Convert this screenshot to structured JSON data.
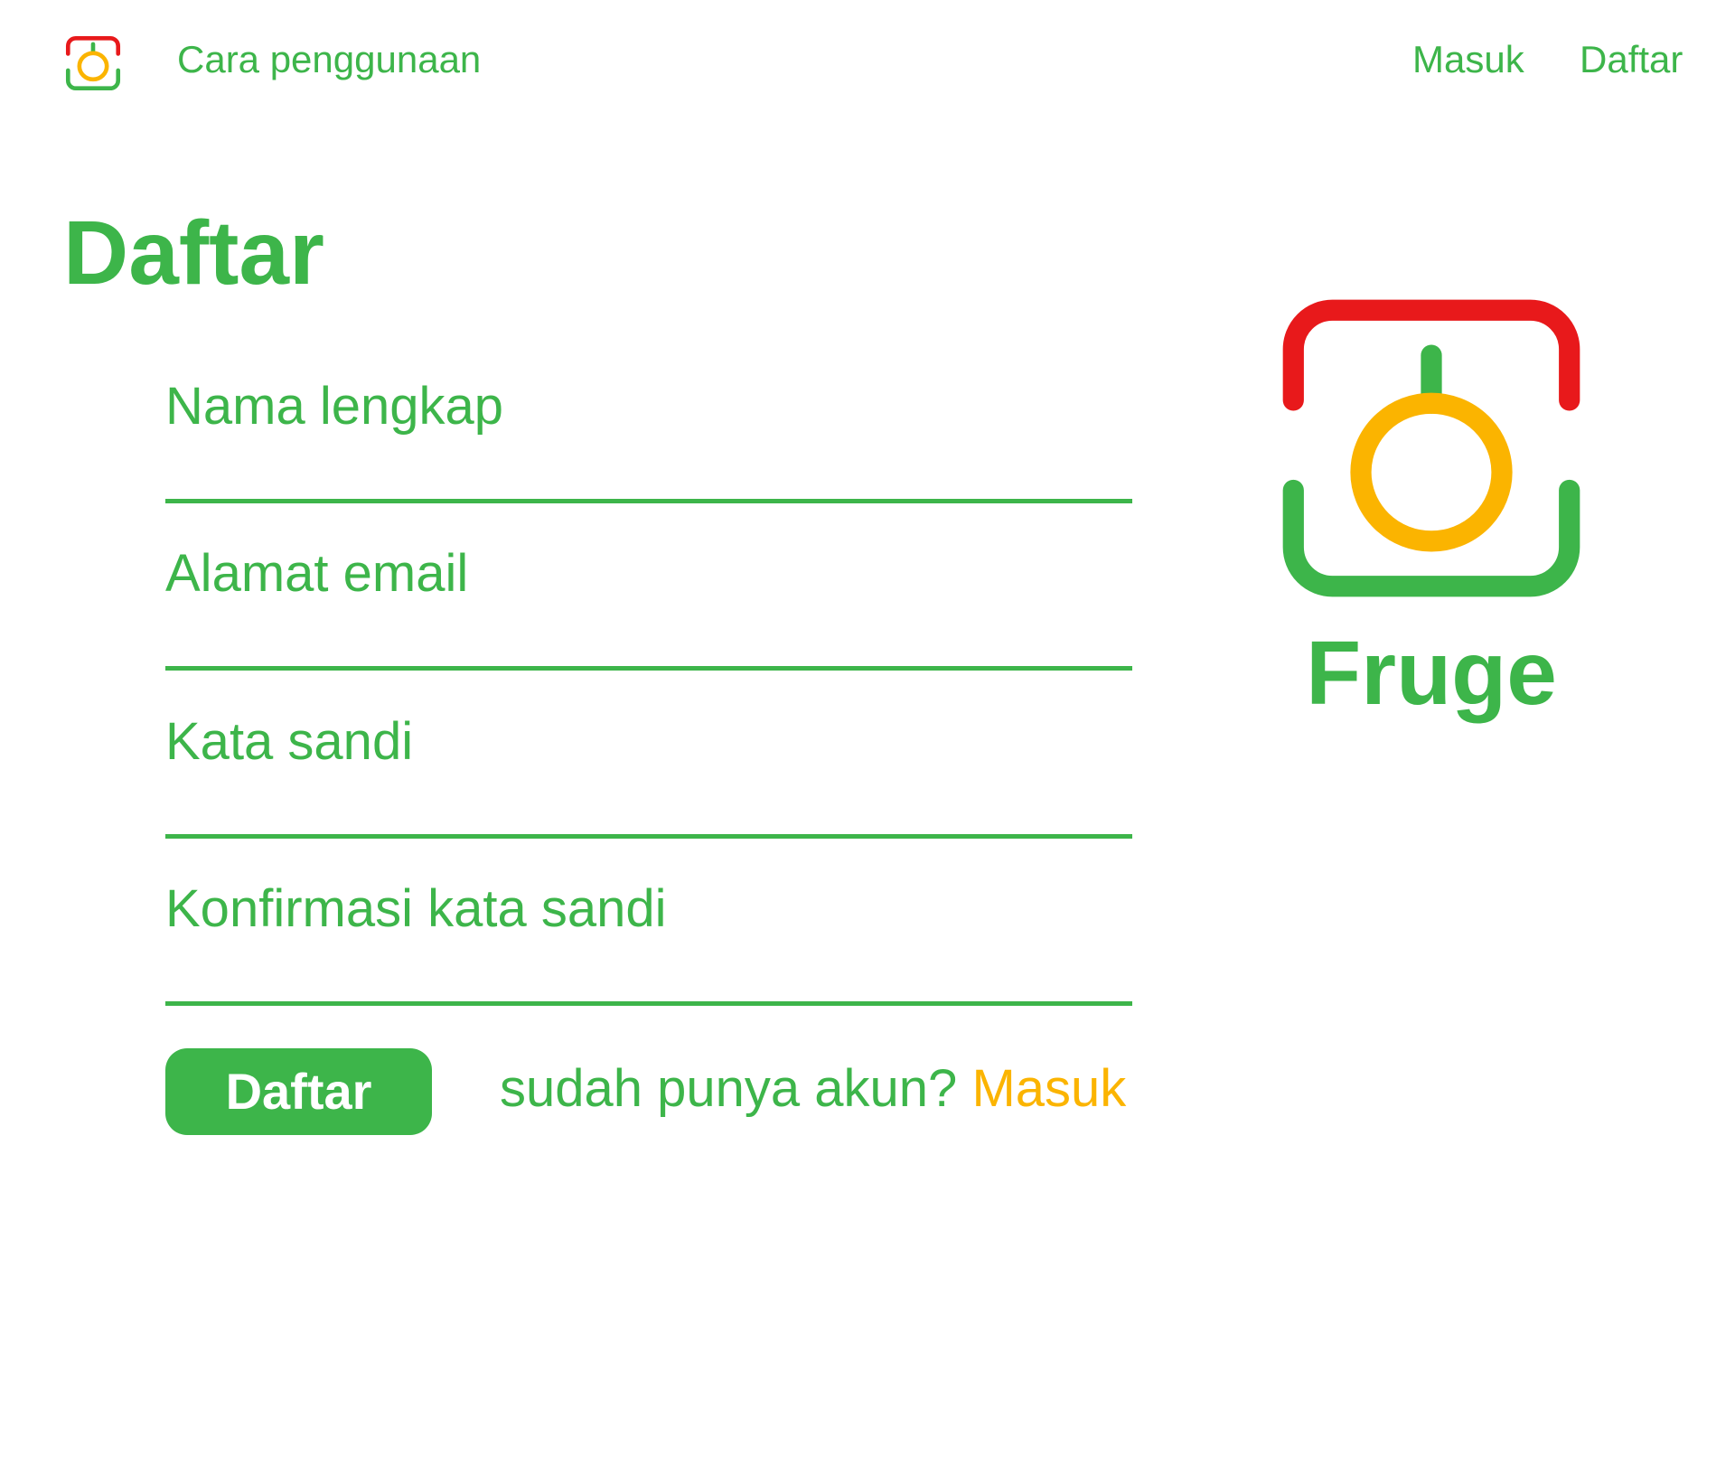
{
  "colors": {
    "brand_green": "#3db54a",
    "accent_yellow": "#fbb400",
    "logo_red": "#e8191b",
    "background": "#ffffff"
  },
  "header": {
    "logo_icon": "fruge-logo-icon",
    "nav_left": {
      "howto_label": "Cara penggunaan"
    },
    "nav_right": {
      "login_label": "Masuk",
      "register_label": "Daftar"
    }
  },
  "page": {
    "title": "Daftar"
  },
  "form": {
    "fields": [
      {
        "label": "Nama lengkap",
        "value": ""
      },
      {
        "label": "Alamat email",
        "value": ""
      },
      {
        "label": "Kata sandi",
        "value": ""
      },
      {
        "label": "Konfirmasi kata sandi",
        "value": ""
      }
    ],
    "submit_label": "Daftar",
    "login_prompt": "sudah punya akun?",
    "login_link": "Masuk"
  },
  "brand": {
    "logo_icon": "fruge-logo-icon",
    "name": "Fruge"
  }
}
